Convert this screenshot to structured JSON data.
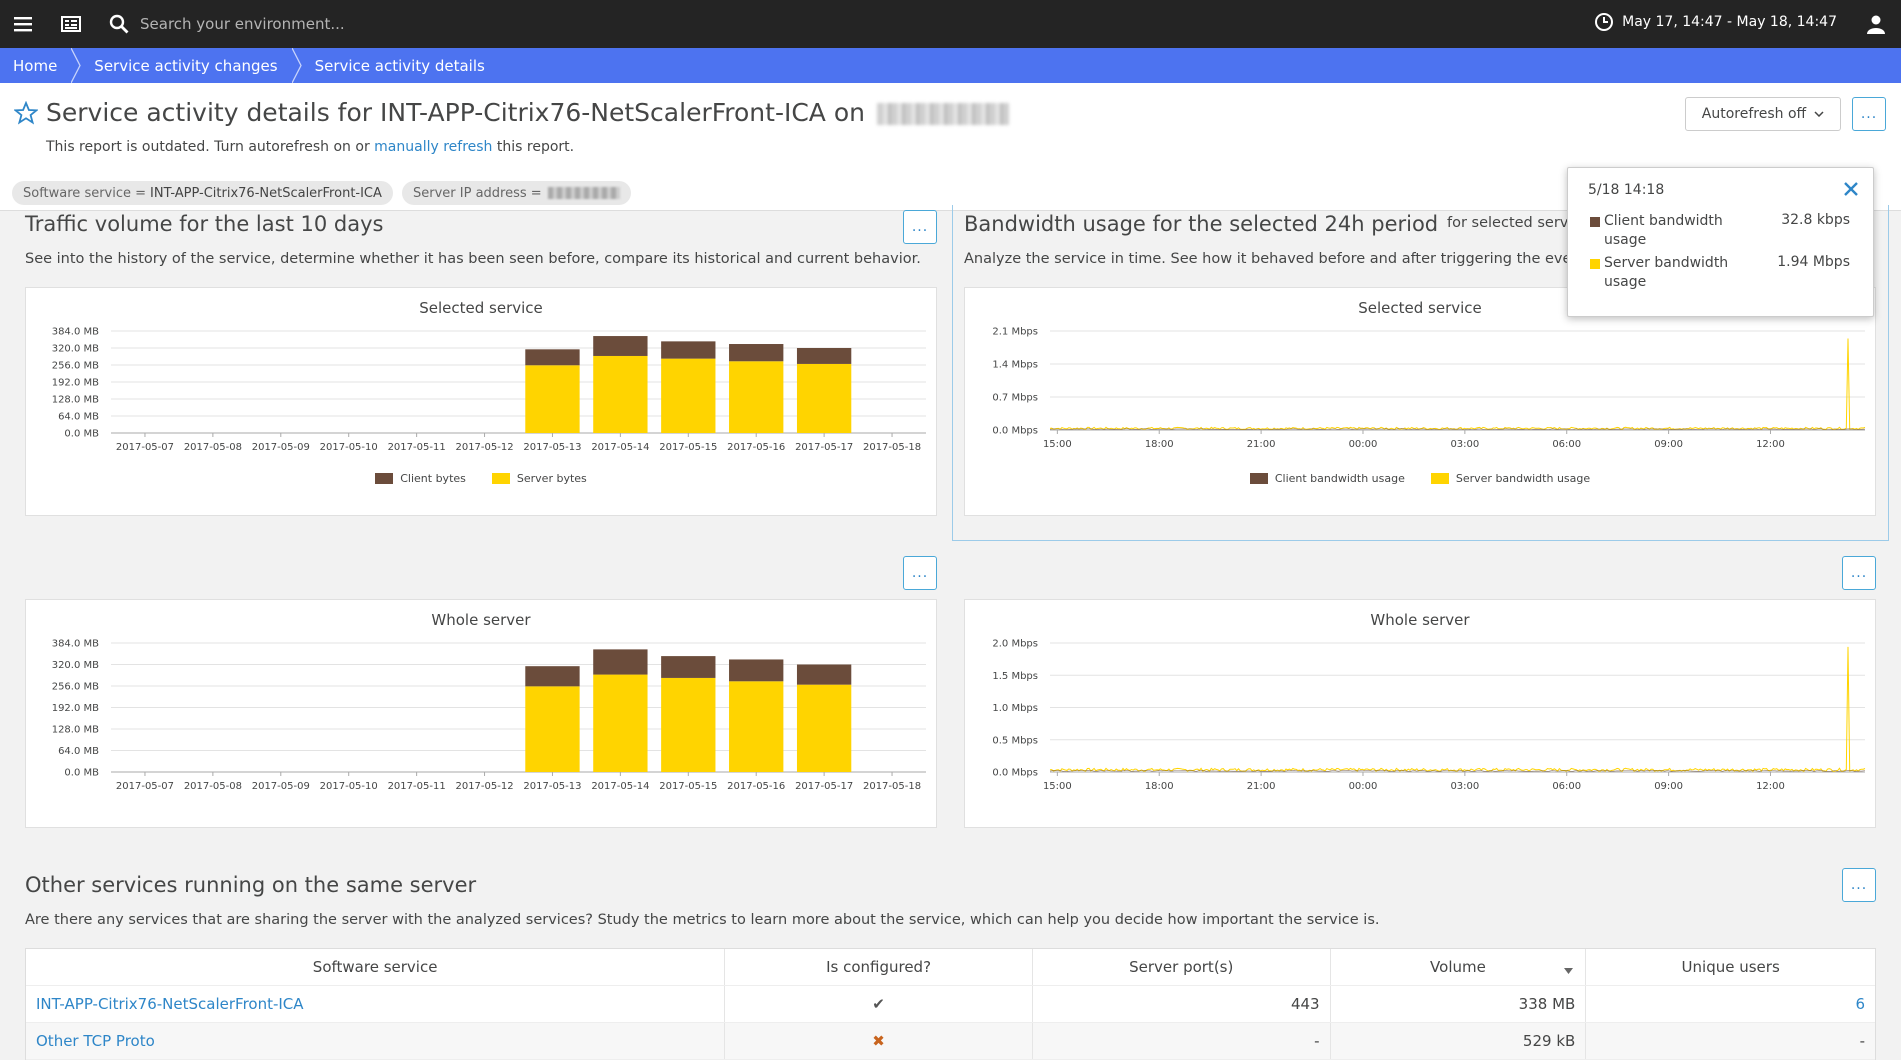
{
  "topbar": {
    "search_placeholder": "Search your environment...",
    "timeframe": "May 17, 14:47 - May 18, 14:47"
  },
  "breadcrumb": [
    "Home",
    "Service activity changes",
    "Service activity details"
  ],
  "header": {
    "title": "Service activity details for INT-APP-Citrix76-NetScalerFront-ICA on",
    "outdated_prefix": "This report is outdated. Turn autorefresh on or",
    "outdated_link": "manually refresh",
    "outdated_suffix": "this report.",
    "autorefresh_label": "Autorefresh off",
    "more_label": "...",
    "filters": [
      {
        "key": "Software service =",
        "value": "INT-APP-Citrix76-NetScalerFront-ICA"
      },
      {
        "key": "Server IP address =",
        "value": ""
      }
    ]
  },
  "traffic": {
    "title": "Traffic volume for the last 10 days",
    "desc": "See into the history of the service, determine whether it has been seen before, compare its historical and current behavior.",
    "more_label": "..."
  },
  "bandwidth": {
    "title": "Bandwidth usage for the selected 24h period",
    "title_suffix": "for selected servi",
    "desc": "Analyze the service in time. See how it behaved before and after triggering the event.",
    "more_label": "..."
  },
  "tooltip": {
    "time": "5/18 14:18",
    "rows": [
      {
        "label": "Client bandwidth usage",
        "value": "32.8 kbps",
        "color": "#6b4c3b"
      },
      {
        "label": "Server bandwidth usage",
        "value": "1.94 Mbps",
        "color": "#ffd400"
      }
    ]
  },
  "colors": {
    "client": "#6b4c3b",
    "server": "#ffd400",
    "accent": "#4d73f0",
    "link": "#2e86c8"
  },
  "chart_data": [
    {
      "type": "bar",
      "title": "Selected service",
      "categories": [
        "2017-05-07",
        "2017-05-08",
        "2017-05-09",
        "2017-05-10",
        "2017-05-11",
        "2017-05-12",
        "2017-05-13",
        "2017-05-14",
        "2017-05-15",
        "2017-05-16",
        "2017-05-17",
        "2017-05-18"
      ],
      "y_ticks": [
        "384.0 MB",
        "320.0 MB",
        "256.0 MB",
        "192.0 MB",
        "128.0 MB",
        "64.0 MB",
        "0.0 MB"
      ],
      "ylim": [
        0,
        384
      ],
      "stacked": true,
      "series": [
        {
          "name": "Server bytes",
          "values": [
            0,
            0,
            0,
            0,
            0,
            0,
            255,
            290,
            280,
            270,
            260,
            null
          ]
        },
        {
          "name": "Client bytes",
          "values": [
            0,
            0,
            0,
            0,
            0,
            0,
            60,
            75,
            65,
            65,
            60,
            null
          ]
        }
      ],
      "legend": [
        "Client bytes",
        "Server bytes"
      ]
    },
    {
      "type": "line",
      "title": "Selected service",
      "x_ticks": [
        "15:00",
        "18:00",
        "21:00",
        "00:00",
        "03:00",
        "06:00",
        "09:00",
        "12:00"
      ],
      "y_ticks": [
        "2.1 Mbps",
        "1.4 Mbps",
        "0.7 Mbps",
        "0.0 Mbps"
      ],
      "ylim": [
        0,
        2.1
      ],
      "series": [
        {
          "name": "Client bandwidth usage",
          "baseline": 0.03
        },
        {
          "name": "Server bandwidth usage",
          "baseline": 0.03,
          "spike": {
            "x": "14:18",
            "value": 1.94
          }
        }
      ],
      "legend": [
        "Client bandwidth usage",
        "Server bandwidth usage"
      ]
    },
    {
      "type": "bar",
      "title": "Whole server",
      "categories": [
        "2017-05-07",
        "2017-05-08",
        "2017-05-09",
        "2017-05-10",
        "2017-05-11",
        "2017-05-12",
        "2017-05-13",
        "2017-05-14",
        "2017-05-15",
        "2017-05-16",
        "2017-05-17",
        "2017-05-18"
      ],
      "y_ticks": [
        "384.0 MB",
        "320.0 MB",
        "256.0 MB",
        "192.0 MB",
        "128.0 MB",
        "64.0 MB",
        "0.0 MB"
      ],
      "ylim": [
        0,
        384
      ],
      "stacked": true,
      "series": [
        {
          "name": "Server bytes",
          "values": [
            0,
            0,
            0,
            0,
            0,
            0,
            255,
            290,
            280,
            270,
            260,
            null
          ]
        },
        {
          "name": "Client bytes",
          "values": [
            0,
            0,
            0,
            0,
            0,
            0,
            60,
            75,
            65,
            65,
            60,
            null
          ]
        }
      ]
    },
    {
      "type": "line",
      "title": "Whole server",
      "x_ticks": [
        "15:00",
        "18:00",
        "21:00",
        "00:00",
        "03:00",
        "06:00",
        "09:00",
        "12:00"
      ],
      "y_ticks": [
        "2.0 Mbps",
        "1.5 Mbps",
        "1.0 Mbps",
        "0.5 Mbps",
        "0.0 Mbps"
      ],
      "ylim": [
        0,
        2.0
      ],
      "series": [
        {
          "name": "Client bandwidth usage",
          "baseline": 0.03
        },
        {
          "name": "Server bandwidth usage",
          "baseline": 0.03,
          "spike": {
            "x": "14:18",
            "value": 1.94
          }
        }
      ]
    }
  ],
  "others": {
    "title": "Other services running on the same server",
    "desc": "Are there any services that are sharing the server with the analyzed services? Study the metrics to learn more about the service, which can help you decide how important the service is.",
    "more_label": "...",
    "columns": [
      "Software service",
      "Is configured?",
      "Server port(s)",
      "Volume",
      "Unique users"
    ],
    "rows": [
      {
        "service": "INT-APP-Citrix76-NetScalerFront-ICA",
        "configured": "✔",
        "ports": "443",
        "volume": "338 MB",
        "users": "6"
      },
      {
        "service": "Other TCP Proto",
        "configured": "✖",
        "ports": "-",
        "volume": "529 kB",
        "users": "-"
      }
    ]
  }
}
